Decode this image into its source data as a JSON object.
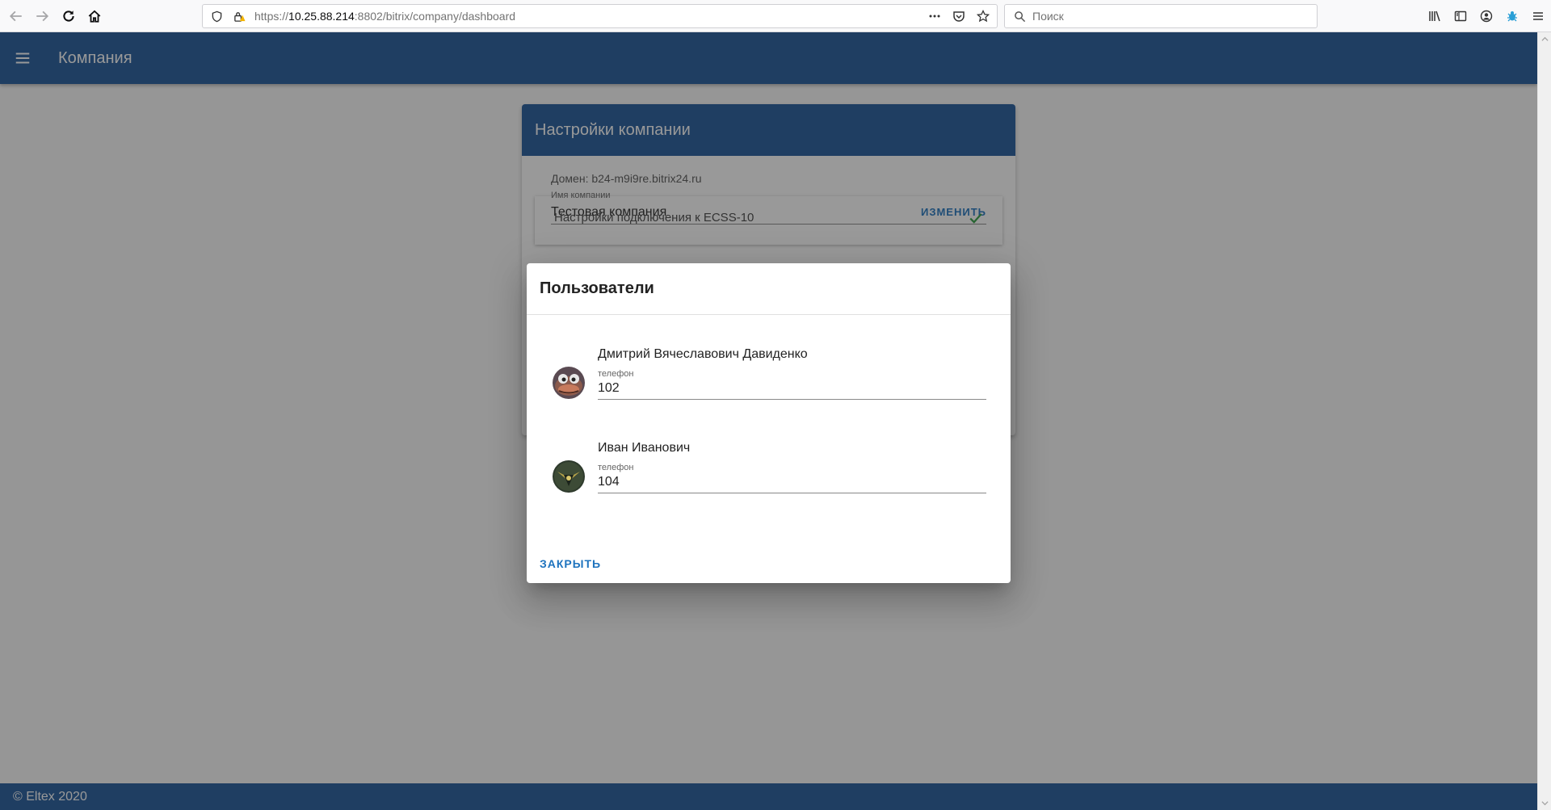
{
  "browser": {
    "url_host": "10.25.88.214",
    "url_scheme": "https://",
    "url_path": ":8802/bitrix/company/dashboard",
    "search_placeholder": "Поиск",
    "icons": [
      "back-icon",
      "forward-icon",
      "reload-icon",
      "home-icon",
      "shield-icon",
      "lock-warning-icon",
      "more-icon",
      "pocket-icon",
      "star-icon",
      "search-icon",
      "library-icon",
      "sidebar-icon",
      "account-icon",
      "extension-icon",
      "menu-icon"
    ]
  },
  "app_bar": {
    "title": "Компания",
    "menu_icon": "hamburger-icon"
  },
  "settings": {
    "title": "Настройки компании",
    "domain": "Домен: b24-m9i9re.bitrix24.ru",
    "company_name_label": "Имя компании",
    "company_name": "Тестовая компания",
    "change_label": "ИЗМЕНИТЬ",
    "ecss_label": "Настройки подключения к ECSS-10"
  },
  "dialog": {
    "title": "Пользователи",
    "users": [
      {
        "name": "Дмитрий Вячеславович Давиденко",
        "phone_label": "телефон",
        "phone": "102"
      },
      {
        "name": "Иван Иванович",
        "phone_label": "телефон",
        "phone": "104"
      }
    ],
    "close_label": "ЗАКРЫТЬ"
  },
  "footer": {
    "text": "© Eltex 2020"
  },
  "colors": {
    "primary": "#1e5799",
    "accent": "#1e73be",
    "success": "#2e9d40"
  }
}
